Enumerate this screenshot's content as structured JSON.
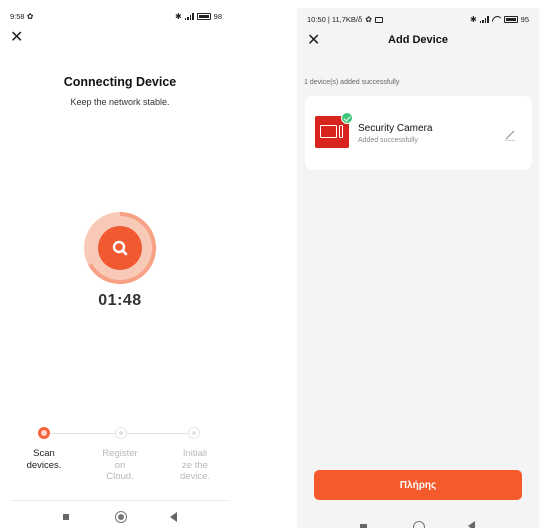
{
  "left_screen": {
    "status_bar": {
      "time": "9:58",
      "battery_percent": "98"
    },
    "title": "Connecting Device",
    "subtitle": "Keep the network stable.",
    "timer": "01:48",
    "steps": [
      {
        "label_lines": [
          "Scan",
          "devices."
        ],
        "state": "active"
      },
      {
        "label_lines": [
          "Register",
          "on",
          "Cloud."
        ],
        "state": "idle"
      },
      {
        "label_lines": [
          "Initiali",
          "ze the",
          "device."
        ],
        "state": "idle"
      }
    ],
    "icons": {
      "close": "close-icon",
      "search": "search-icon",
      "settings": "gear-icon"
    },
    "accent_color": "#f05a32"
  },
  "right_screen": {
    "status_bar": {
      "time_speed": "10:50 | 11,7KB/δ",
      "battery_percent": "95"
    },
    "title": "Add Device",
    "added_count_text": "1 device(s) added successfully",
    "device": {
      "name": "Security Camera",
      "status": "Added successfully"
    },
    "done_button_label": "Πλήρης",
    "icons": {
      "close": "close-icon",
      "edit": "pencil-icon",
      "check": "check-icon",
      "device": "camera-icon"
    },
    "accent_color": "#f45a2b",
    "success_color": "#3ec77a"
  }
}
